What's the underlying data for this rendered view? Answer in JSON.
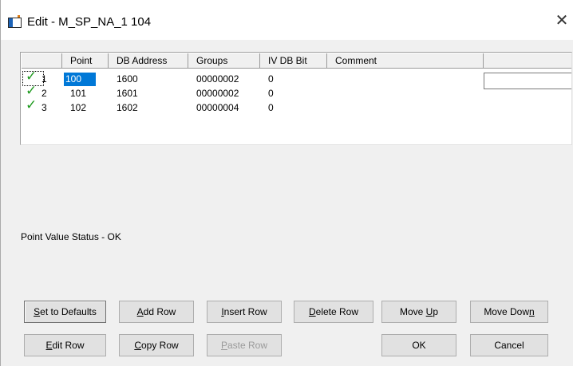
{
  "window": {
    "title": "Edit - M_SP_NA_1 104",
    "close_glyph": "✕"
  },
  "grid": {
    "columns": [
      "",
      "Point",
      "DB Address",
      "Groups",
      "IV DB Bit",
      "Comment",
      ""
    ],
    "rows": [
      {
        "num": "1",
        "point": "100",
        "db_address": "1600",
        "groups": "00000002",
        "iv_db_bit": "0",
        "comment": ""
      },
      {
        "num": "2",
        "point": "101",
        "db_address": "1601",
        "groups": "00000002",
        "iv_db_bit": "0",
        "comment": ""
      },
      {
        "num": "3",
        "point": "102",
        "db_address": "1602",
        "groups": "00000004",
        "iv_db_bit": "0",
        "comment": ""
      }
    ],
    "check_glyph": "✓",
    "check_color": "#1e9a1e",
    "selection_color": "#0078d7"
  },
  "status": {
    "text": "Point Value Status - OK"
  },
  "buttons": {
    "set_defaults": {
      "pre": "",
      "u": "S",
      "post": "et to Defaults"
    },
    "add_row": {
      "pre": "",
      "u": "A",
      "post": "dd Row"
    },
    "insert_row": {
      "pre": "",
      "u": "I",
      "post": "nsert Row"
    },
    "delete_row": {
      "pre": "",
      "u": "D",
      "post": "elete Row"
    },
    "move_up": {
      "pre": "Move ",
      "u": "U",
      "post": "p"
    },
    "move_down": {
      "pre": "Move Dow",
      "u": "n",
      "post": ""
    },
    "edit_row": {
      "pre": "",
      "u": "E",
      "post": "dit Row"
    },
    "copy_row": {
      "pre": "",
      "u": "C",
      "post": "opy Row"
    },
    "paste_row": {
      "pre": "",
      "u": "P",
      "post": "aste Row"
    },
    "ok": "OK",
    "cancel": "Cancel"
  }
}
